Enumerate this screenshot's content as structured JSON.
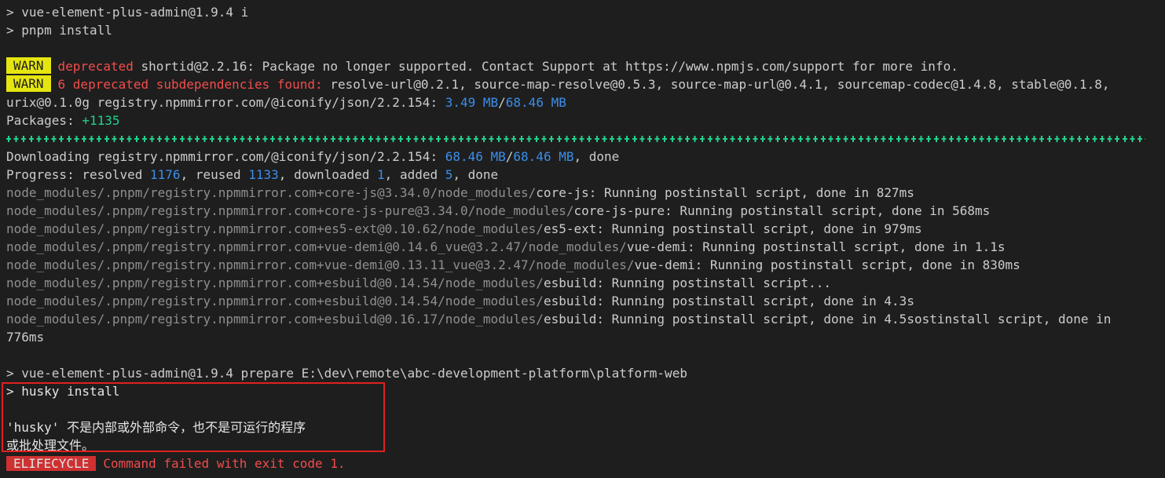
{
  "lines": {
    "l1": "> vue-element-plus-admin@1.9.4 i",
    "l2": "> pnpm install",
    "warn_badge": "WARN",
    "w1_deprecated": "deprecated",
    "w1_text": " shortid@2.2.16: Package no longer supported. Contact Support at https://www.npmjs.com/support for more info.",
    "w2_red": "6 deprecated subdependencies found:",
    "w2_text": " resolve-url@0.2.1, source-map-resolve@0.5.3, source-map-url@0.4.1, sourcemap-codec@1.4.8, stable@0.1.8,",
    "w3_prefix": "urix@0.1.0g registry.npmmirror.com/@iconify/json/2.2.154: ",
    "w3_val1": "3.49 MB",
    "w3_sep": "/",
    "w3_val2": "68.46 MB",
    "pkg_label": "Packages: ",
    "pkg_value": "+1135",
    "dl_prefix": "Downloading registry.npmmirror.com/@iconify/json/2.2.154: ",
    "dl_val1": "68.46 MB",
    "dl_sep": "/",
    "dl_val2": "68.46 MB",
    "dl_suffix": ", done",
    "pr_a": "Progress: resolved ",
    "pr_resolved": "1176",
    "pr_b": ", reused ",
    "pr_reused": "1133",
    "pr_c": ", downloaded ",
    "pr_downloaded": "1",
    "pr_d": ", added ",
    "pr_added": "5",
    "pr_e": ", done",
    "n1_path": "node_modules/.pnpm/registry.npmmirror.com+core-js@3.34.0/node_modules/",
    "n1_rest": "core-js: Running postinstall script, done in 827ms",
    "n2_path": "node_modules/.pnpm/registry.npmmirror.com+core-js-pure@3.34.0/node_modules/",
    "n2_rest": "core-js-pure: Running postinstall script, done in 568ms",
    "n3_path": "node_modules/.pnpm/registry.npmmirror.com+es5-ext@0.10.62/node_modules/",
    "n3_rest": "es5-ext: Running postinstall script, done in 979ms",
    "n4_path": "node_modules/.pnpm/registry.npmmirror.com+vue-demi@0.14.6_vue@3.2.47/node_modules/",
    "n4_rest": "vue-demi: Running postinstall script, done in 1.1s",
    "n5_path": "node_modules/.pnpm/registry.npmmirror.com+vue-demi@0.13.11_vue@3.2.47/node_modules/",
    "n5_rest": "vue-demi: Running postinstall script, done in 830ms",
    "n6_path": "node_modules/.pnpm/registry.npmmirror.com+esbuild@0.14.54/node_modules/",
    "n6_rest": "esbuild: Running postinstall script...",
    "n7_path": "node_modules/.pnpm/registry.npmmirror.com+esbuild@0.14.54/node_modules/",
    "n7_rest": "esbuild: Running postinstall script, done in 4.3s",
    "n8_path": "node_modules/.pnpm/registry.npmmirror.com+esbuild@0.16.17/node_modules/",
    "n8_rest": "esbuild: Running postinstall script, done in 4.5sostinstall script, done in",
    "n8_wrap": "776ms",
    "prep": "> vue-element-plus-admin@1.9.4 prepare E:\\dev\\remote\\abc-development-platform\\platform-web",
    "husky": "> husky install",
    "err1": "'husky' 不是内部或外部命令，也不是可运行的程序",
    "err2": "或批处理文件。",
    "elife_badge": "ELIFECYCLE",
    "elife_text": "Command failed with exit code 1."
  },
  "colors": {
    "background": "#1e1e1e",
    "warn_badge": "#e5e510",
    "error_badge": "#cd3131",
    "red_text": "#f14c4c",
    "blue_text": "#3b8eea",
    "green_text": "#23d18b",
    "highlight_border": "#e02020"
  }
}
